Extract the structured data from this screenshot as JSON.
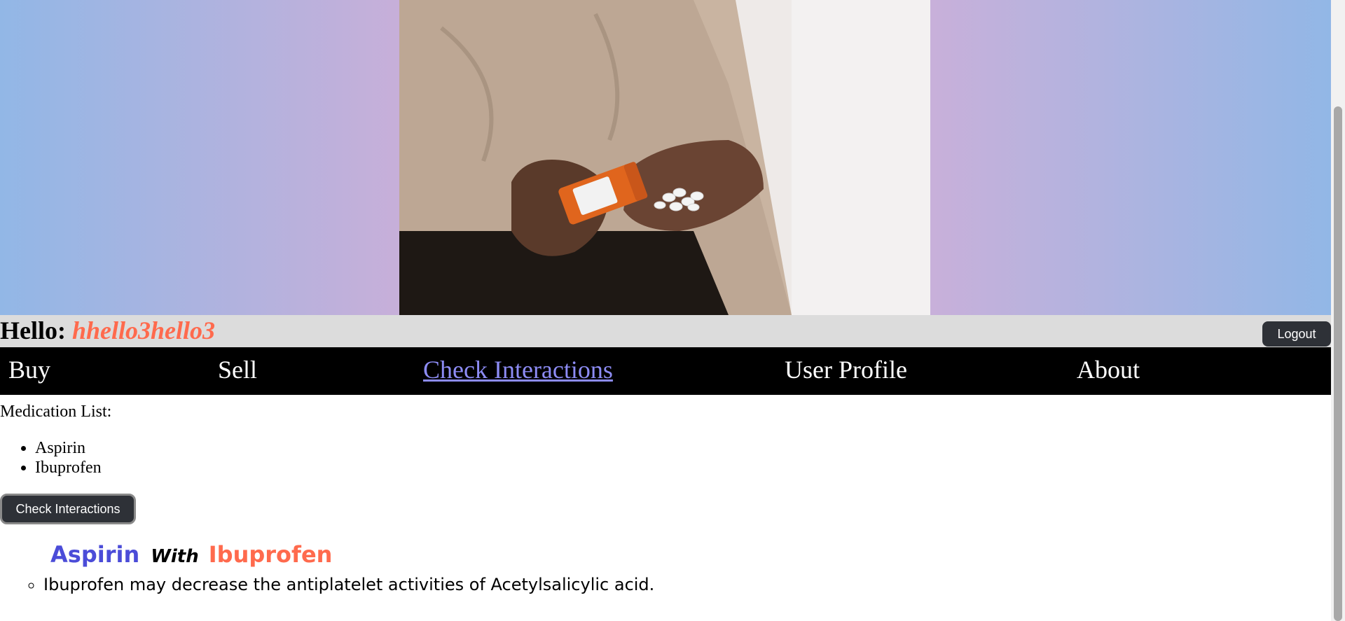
{
  "hero": {
    "image_alt": "Hands holding an orange prescription pill bottle with white pills"
  },
  "header": {
    "greeting_label": "Hello:",
    "username": "hhello3hello3",
    "logout_label": "Logout"
  },
  "nav": {
    "items": [
      {
        "label": "Buy",
        "active": false
      },
      {
        "label": "Sell",
        "active": false
      },
      {
        "label": "Check Interactions",
        "active": true
      },
      {
        "label": "User Profile",
        "active": false
      },
      {
        "label": "About",
        "active": false
      }
    ]
  },
  "main": {
    "medication_list_title": "Medication List:",
    "medications": [
      "Aspirin",
      "Ibuprofen"
    ],
    "check_button_label": "Check Interactions",
    "interaction": {
      "drug_a": "Aspirin",
      "with_word": "With",
      "drug_b": "Ibuprofen",
      "descriptions": [
        "Ibuprofen may decrease the antiplatelet activities of Acetylsalicylic acid."
      ]
    }
  },
  "colors": {
    "accent_username": "#ff6a4d",
    "accent_drug_a": "#4b4cd8",
    "nav_active": "#8d8cf5",
    "button_bg": "#2e3137"
  }
}
